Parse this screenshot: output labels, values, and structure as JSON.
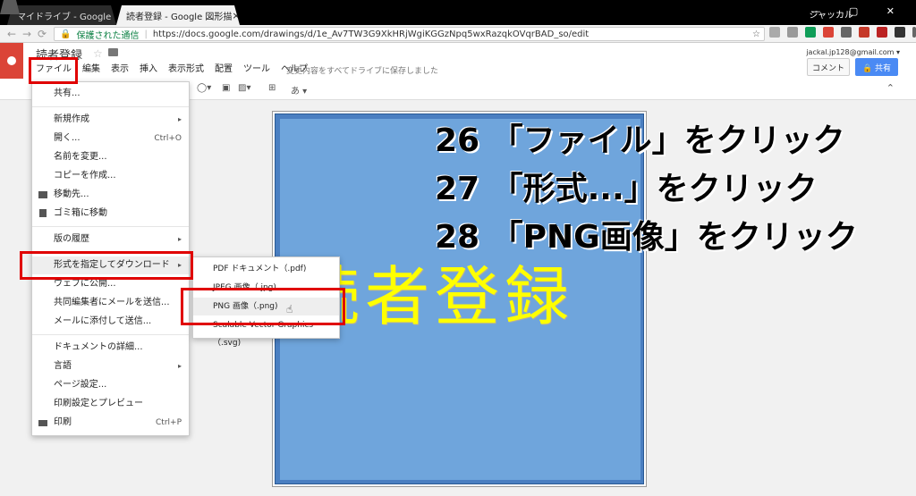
{
  "browser": {
    "tabs": [
      {
        "title": "マイドライブ - Google ドライ",
        "close": "×"
      },
      {
        "title": "読者登録 - Google 図形描",
        "close": "×"
      }
    ],
    "user": "ジャッカル",
    "window_controls": "— ▢ ✕",
    "secure_label": "保護された通信",
    "url": "https://docs.google.com/drawings/d/1e_Av7TW3G9XkHRjWgiKGGzNpq5wxRazqkOVqrBAD_so/edit"
  },
  "app": {
    "doc_title": "読者登録",
    "menu": [
      "ファイル",
      "編集",
      "表示",
      "挿入",
      "表示形式",
      "配置",
      "ツール",
      "ヘルプ"
    ],
    "saved_status": "変更内容をすべてドライブに保存しました",
    "email": "jackal.jp128@gmail.com ▾",
    "comment_label": "コメント",
    "share_label": "🔒 共有"
  },
  "toolbar": {
    "text_tool": "あ ▾",
    "collapse": "⌃"
  },
  "file_menu": {
    "items": [
      {
        "label": "共有..."
      },
      {
        "label": "新規作成",
        "arrow": "▸"
      },
      {
        "label": "開く...",
        "shortcut": "Ctrl+O"
      },
      {
        "label": "名前を変更..."
      },
      {
        "label": "コピーを作成..."
      },
      {
        "label": "移動先..."
      },
      {
        "label": "ゴミ箱に移動"
      },
      {
        "label": "版の履歴",
        "arrow": "▸"
      },
      {
        "label": "形式を指定してダウンロード",
        "arrow": "▸"
      },
      {
        "label": "ウェブに公開..."
      },
      {
        "label": "共同編集者にメールを送信..."
      },
      {
        "label": "メールに添付して送信..."
      },
      {
        "label": "ドキュメントの詳細..."
      },
      {
        "label": "言語",
        "arrow": "▸"
      },
      {
        "label": "ページ設定..."
      },
      {
        "label": "印刷設定とプレビュー"
      },
      {
        "label": "印刷",
        "shortcut": "Ctrl+P"
      }
    ]
  },
  "download_submenu": {
    "items": [
      {
        "label": "PDF ドキュメント（.pdf)"
      },
      {
        "label": "JPEG 画像（.jpg)"
      },
      {
        "label": "PNG 画像（.png)"
      },
      {
        "label": "Scalable Vector Graphics（.svg)"
      }
    ]
  },
  "canvas": {
    "shape_text": "読者登録"
  },
  "annotations": [
    "26 「ファイル」をクリック",
    "27 「形式...」をクリック",
    "28 「PNG画像」をクリック"
  ],
  "colors": {
    "shape_fill": "#6fa5dc",
    "shape_text": "#ffff00",
    "highlight_box": "#e00000",
    "share": "#4a8af4"
  }
}
